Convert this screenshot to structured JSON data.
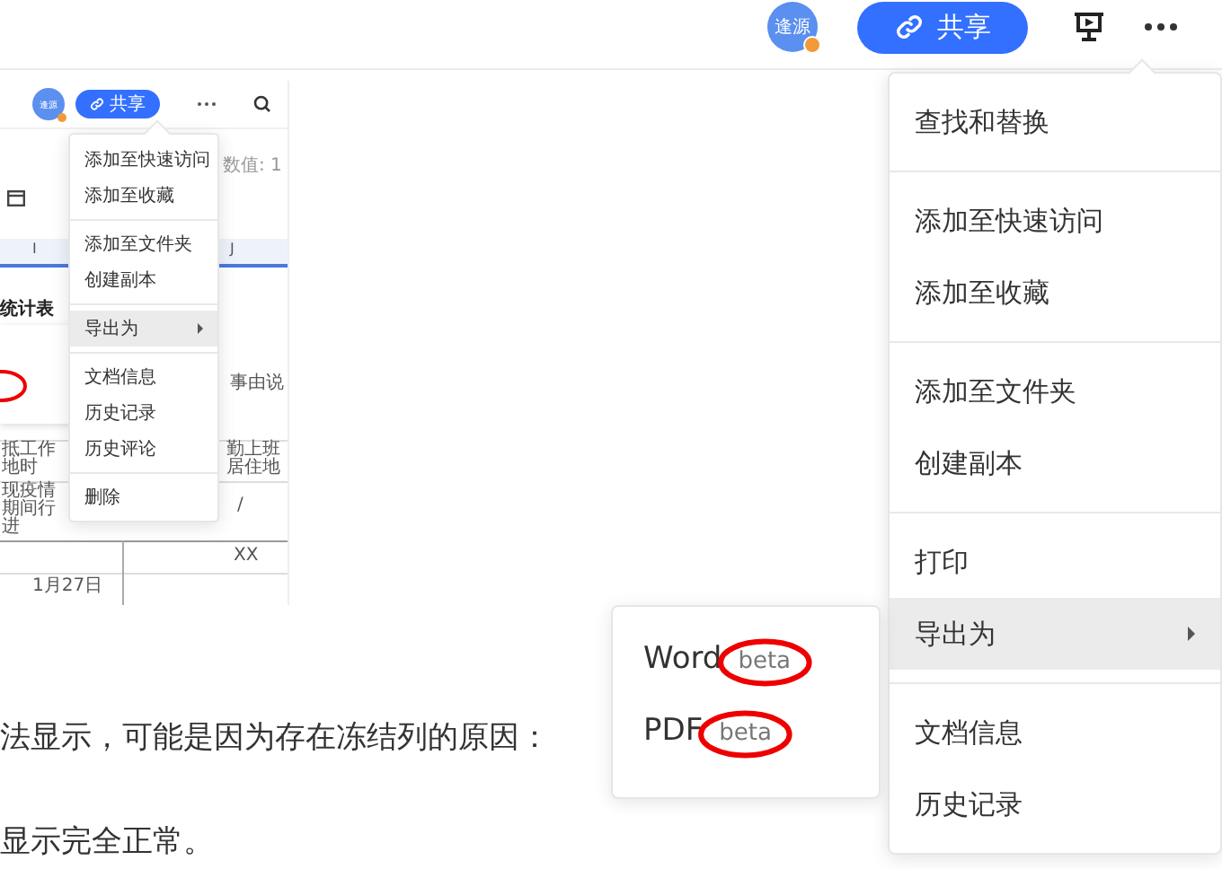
{
  "top_bar": {
    "avatar": "逢源",
    "share_button": "共享"
  },
  "inset_screenshot": {
    "avatar": "逢源",
    "share_button": "共享",
    "count_label": "数值: 1",
    "column_headers": [
      "I",
      "J"
    ],
    "title": "统计表",
    "cells": [
      {
        "text": "事由说",
        "kind": "right"
      },
      {
        "text": "抵工作地时",
        "kind": "left"
      },
      {
        "text": "勤上班居住地",
        "kind": "right"
      },
      {
        "text": "现疫情期间行进",
        "kind": "left"
      },
      {
        "text": "/",
        "kind": "right"
      },
      {
        "text": "XX",
        "kind": "right"
      },
      {
        "text": "1月27日",
        "kind": "left"
      }
    ],
    "menu": {
      "groups": [
        {
          "items": [
            {
              "label": "添加至快速访问",
              "selected": false,
              "submenu": false
            },
            {
              "label": "添加至收藏",
              "selected": false,
              "submenu": false
            }
          ]
        },
        {
          "items": [
            {
              "label": "添加至文件夹",
              "selected": false,
              "submenu": false
            },
            {
              "label": "创建副本",
              "selected": false,
              "submenu": false
            }
          ]
        },
        {
          "items": [
            {
              "label": "导出为",
              "selected": true,
              "submenu": true
            }
          ]
        },
        {
          "items": [
            {
              "label": "文档信息",
              "selected": false,
              "submenu": false
            },
            {
              "label": "历史记录",
              "selected": false,
              "submenu": false
            },
            {
              "label": "历史评论",
              "selected": false,
              "submenu": false
            }
          ]
        },
        {
          "items": [
            {
              "label": "删除",
              "selected": false,
              "submenu": false
            }
          ]
        }
      ]
    }
  },
  "article": {
    "lines": [
      "法显示，可能是因为存在冻结列的原因：",
      "显示完全正常。"
    ]
  },
  "menu": {
    "groups": [
      {
        "items": [
          {
            "label": "查找和替换",
            "selected": false,
            "submenu": false
          }
        ]
      },
      {
        "items": [
          {
            "label": "添加至快速访问",
            "selected": false,
            "submenu": false
          },
          {
            "label": "添加至收藏",
            "selected": false,
            "submenu": false
          }
        ]
      },
      {
        "items": [
          {
            "label": "添加至文件夹",
            "selected": false,
            "submenu": false
          },
          {
            "label": "创建副本",
            "selected": false,
            "submenu": false
          }
        ]
      },
      {
        "items": [
          {
            "label": "打印",
            "selected": false,
            "submenu": false
          },
          {
            "label": "导出为",
            "selected": true,
            "submenu": true
          }
        ]
      },
      {
        "items": [
          {
            "label": "文档信息",
            "selected": false,
            "submenu": false
          },
          {
            "label": "历史记录",
            "selected": false,
            "submenu": false
          }
        ]
      }
    ]
  },
  "submenu": {
    "items": [
      {
        "label": "Word",
        "badge": "beta"
      },
      {
        "label": "PDF",
        "badge": "beta"
      }
    ]
  }
}
